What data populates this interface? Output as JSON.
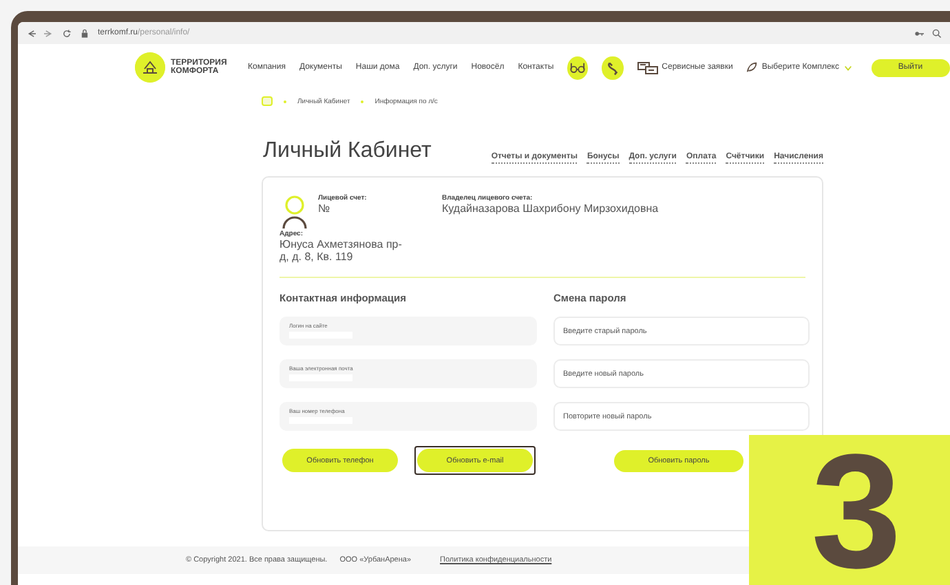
{
  "browser": {
    "url_host": "terrkomf.ru",
    "url_path": "/personal/info/"
  },
  "header": {
    "logo_text": "ТЕРРИТОРИЯ КОМФОРТА",
    "nav": [
      "Компания",
      "Документы",
      "Наши дома",
      "Доп. услуги",
      "Новосёл",
      "Контакты"
    ],
    "service_link": "Сервисные заявки",
    "complex_select": "Выберите Комплекс",
    "logout": "Выйти"
  },
  "breadcrumbs": [
    "Личный Кабинет",
    "Информация по л/с"
  ],
  "page_title": "Личный Кабинет",
  "tabs": [
    "Отчеты и документы",
    "Бонусы",
    "Доп. услуги",
    "Оплата",
    "Счётчики",
    "Начисления"
  ],
  "account": {
    "account_label": "Лицевой счет:",
    "account_value": "№",
    "owner_label": "Владелец лицевого счета:",
    "owner_value": "Кудайназарова Шахрибону Мирзохидовна",
    "address_label": "Адрес:",
    "address_value": "Юнуса Ахметзянова пр-д, д. 8, Кв. 119"
  },
  "contact": {
    "title": "Контактная информация",
    "fields": [
      {
        "label": "Логин на сайте"
      },
      {
        "label": "Ваша электронная почта"
      },
      {
        "label": "Ваш номер телефона"
      }
    ],
    "buttons": [
      {
        "label": "Обновить телефон",
        "focused": false
      },
      {
        "label": "Обновить e-mail",
        "focused": true
      }
    ]
  },
  "password": {
    "title": "Смена пароля",
    "fields": [
      {
        "placeholder": "Введите старый пароль"
      },
      {
        "placeholder": "Введите новый пароль"
      },
      {
        "placeholder": "Повторите новый пароль"
      }
    ],
    "button": "Обновить пароль"
  },
  "footer": {
    "copyright": "© Copyright 2021. Все права защищены.",
    "company": "ООО «УрбанАрена»",
    "policy": "Политика конфиденциальности"
  },
  "step_badge": "3"
}
